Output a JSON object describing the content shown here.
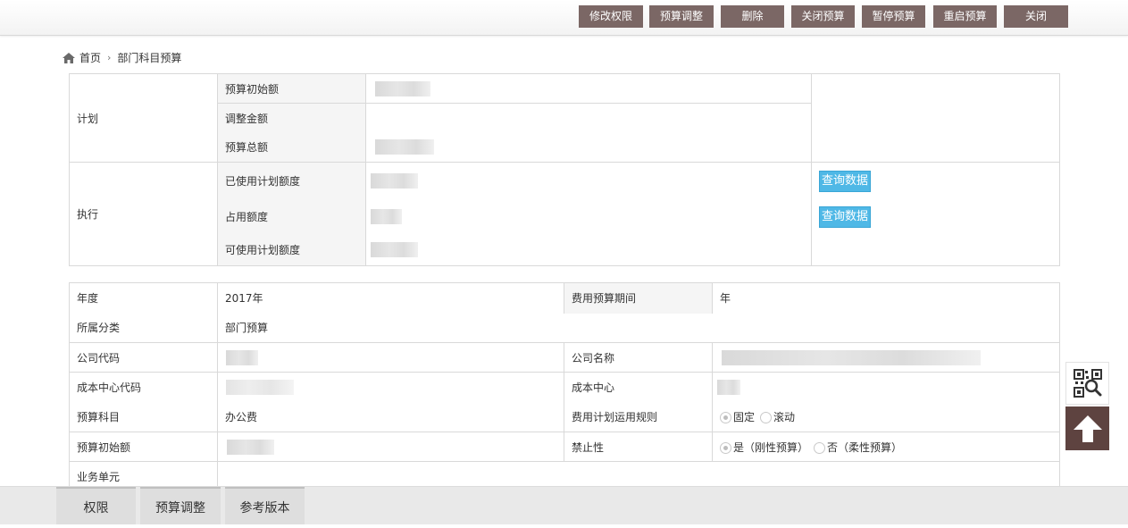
{
  "toolbar": {
    "buttons": [
      {
        "label": "修改权限"
      },
      {
        "label": "预算调整"
      },
      {
        "label": "删除"
      },
      {
        "label": "关闭预算"
      },
      {
        "label": "暂停预算"
      },
      {
        "label": "重启预算"
      },
      {
        "label": "关闭"
      }
    ],
    "button_color": "#7b6765"
  },
  "breadcrumb": {
    "home": "首页",
    "current": "部门科目预算"
  },
  "plan_section": {
    "plan_label": "计划",
    "initial_label": "预算初始额",
    "adjust_label": "调整金额",
    "total_label": "预算总额",
    "exec_label": "执行",
    "used_label": "已使用计划额度",
    "occupied_label": "占用额度",
    "available_label": "可使用计划额度",
    "query_label": "查询数据",
    "query_color": "#4fb8e6"
  },
  "info_section": {
    "year_label": "年度",
    "year_value": "2017年",
    "period_label": "费用预算期间",
    "period_value": "年",
    "category_label": "所属分类",
    "category_value": "部门预算",
    "company_code_label": "公司代码",
    "company_name_label": "公司名称",
    "cost_center_code_label": "成本中心代码",
    "cost_center_label": "成本中心",
    "subject_label": "预算科目",
    "subject_value": "办公费",
    "rule_label": "费用计划运用规则",
    "rule_options": [
      "固定",
      "滚动"
    ],
    "rule_selected": "固定",
    "initial_label": "预算初始额",
    "prohibit_label": "禁止性",
    "prohibit_options": [
      "是（刚性预算）",
      "否（柔性预算）"
    ],
    "prohibit_selected": "是（刚性预算）",
    "business_unit_label": "业务单元"
  },
  "side_tools": {
    "qr_icon": "qr-search-icon",
    "top_icon": "arrow-up-icon",
    "top_color": "#5e4340"
  },
  "bottom_tabs": [
    {
      "label": "权限"
    },
    {
      "label": "预算调整"
    },
    {
      "label": "参考版本"
    }
  ]
}
